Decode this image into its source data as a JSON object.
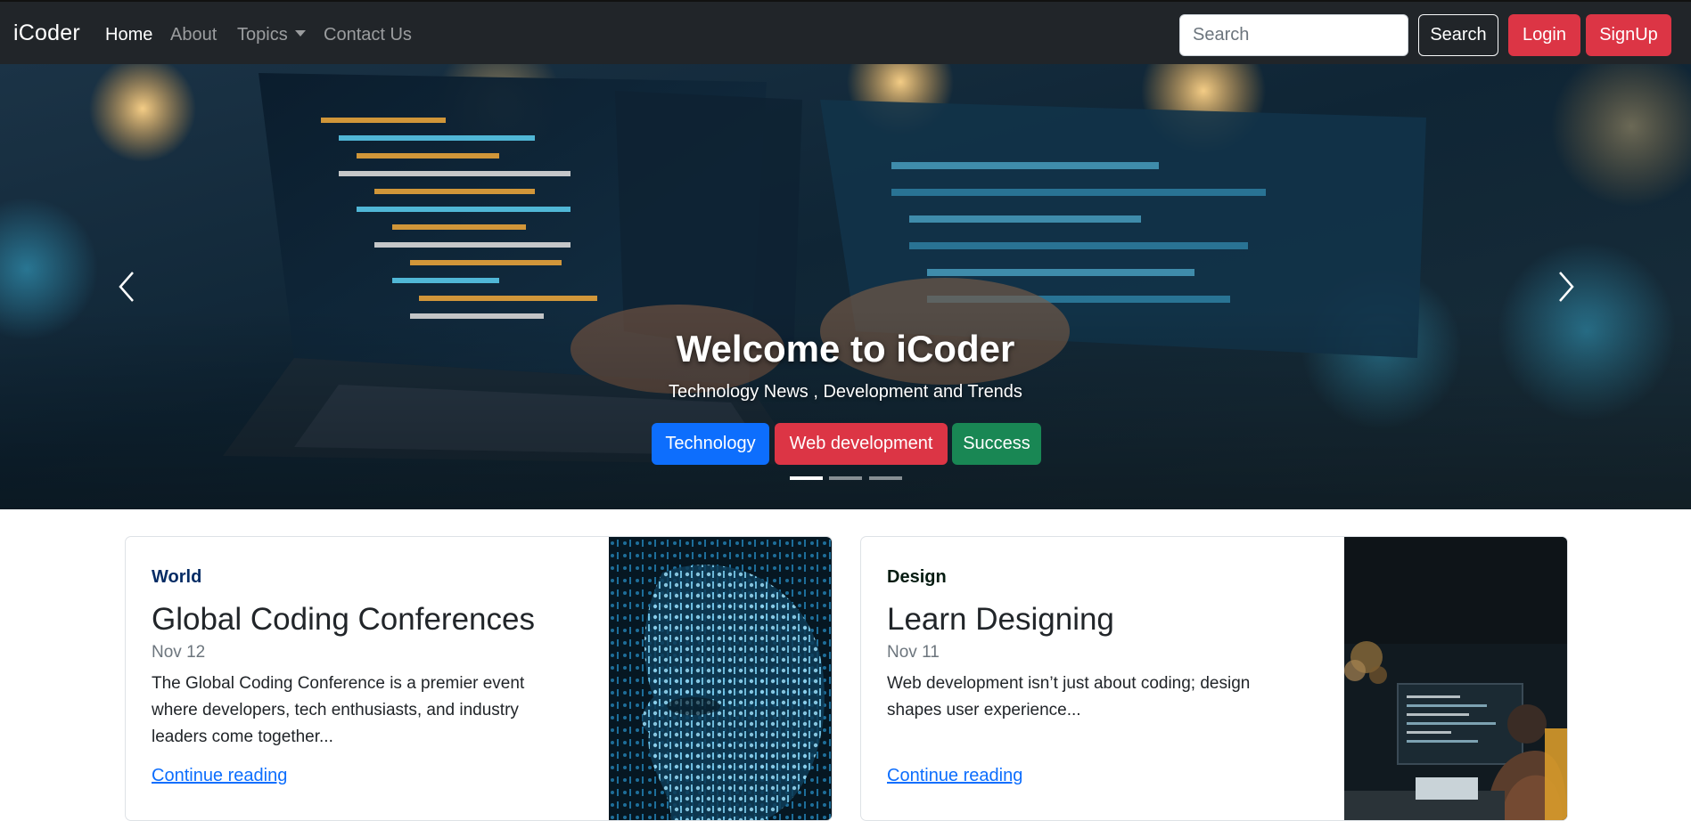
{
  "navbar": {
    "brand": "iCoder",
    "links": [
      {
        "label": "Home",
        "active": true
      },
      {
        "label": "About",
        "active": false
      },
      {
        "label": "Topics",
        "active": false,
        "dropdown": true
      },
      {
        "label": "Contact Us",
        "active": false
      }
    ],
    "search_placeholder": "Search",
    "search_button": "Search",
    "login_button": "Login",
    "signup_button": "SignUp"
  },
  "carousel": {
    "title": "Welcome to iCoder",
    "subtitle": "Technology News , Development and Trends",
    "buttons": [
      {
        "label": "Technology",
        "color": "#0d6efd"
      },
      {
        "label": "Web development",
        "color": "#dc3545"
      },
      {
        "label": "Success",
        "color": "#198754"
      }
    ],
    "indicators": 3,
    "active_indicator": 0,
    "prev_icon": "chevron-left-icon",
    "next_icon": "chevron-right-icon"
  },
  "cards": [
    {
      "category": "World",
      "title": "Global Coding Conferences",
      "date": "Nov 12",
      "text": "The Global Coding Conference is a premier event where developers, tech enthusiasts, and industry leaders come together...",
      "link": "Continue reading"
    },
    {
      "category": "Design",
      "title": "Learn Designing",
      "date": "Nov 11",
      "text": "Web development isn’t just about coding; design shapes user experience...",
      "link": "Continue reading"
    }
  ],
  "colors": {
    "navbar_bg": "#212529",
    "primary": "#0d6efd",
    "danger": "#dc3545",
    "success": "#198754"
  }
}
